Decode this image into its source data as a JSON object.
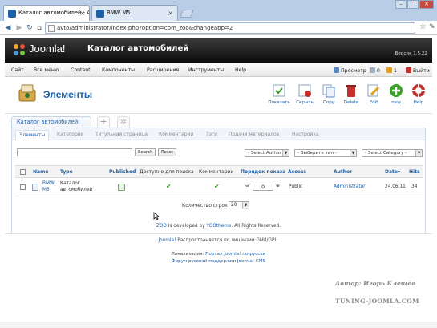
{
  "browser": {
    "tabs": [
      {
        "label": "Каталог автомобилей - А",
        "active": true
      },
      {
        "label": "BMW M5",
        "active": false
      }
    ],
    "url": "avto/administrator/index.php?option=com_zoo&changeapp=2",
    "controls": {
      "minimize": "–",
      "maximize": "□",
      "close": "✕"
    },
    "icons": [
      "back-arrow-icon",
      "forward-arrow-icon",
      "reload-icon",
      "home-icon",
      "star-icon",
      "wrench-icon"
    ]
  },
  "header": {
    "brand": "Joomla!",
    "site_name": "Каталог автомобилей",
    "version": "Версия 1.5.22"
  },
  "menu": {
    "items": [
      "Сайт",
      "Все меню",
      "Content",
      "Компоненты",
      "Расширения",
      "Инструменты",
      "Help"
    ],
    "status": [
      {
        "label": "Просмотр"
      },
      {
        "label": "0"
      },
      {
        "label": "1"
      },
      {
        "label": "Выйти"
      }
    ]
  },
  "toolbar": {
    "title": "Элементы",
    "buttons": [
      {
        "label": "Показать",
        "color": "#3aa227"
      },
      {
        "label": "Скрыть",
        "color": "#c4302b"
      },
      {
        "label": "Copy",
        "color": "#5a8ac4"
      },
      {
        "label": "Delete",
        "color": "#c4302b"
      },
      {
        "label": "Edit",
        "color": "#e0a020"
      },
      {
        "label": "new",
        "color": "#3aa227"
      },
      {
        "label": "Help",
        "color": "#c4302b"
      }
    ]
  },
  "app_tabs": {
    "main": "Каталог автомобилей",
    "plus": "+",
    "gear": "✲"
  },
  "subtabs": [
    "Элементы",
    "Категории",
    "Титульная страница",
    "Комментарии",
    "Тэги",
    "Подачи материалов",
    "Настройка"
  ],
  "filters": {
    "search_value": "",
    "search_button": "Search",
    "reset_button": "Reset",
    "author": "- Select Author -",
    "type": "- Выберите тип -",
    "category": "- Select Category -"
  },
  "table": {
    "headers": {
      "name": "Name",
      "type": "Type",
      "published": "Published",
      "searchable": "Доступно для поиска",
      "comments": "Комментарии",
      "order": "Порядок показа",
      "access": "Access",
      "author": "Author",
      "date": "Date",
      "date_arrow": "▾",
      "hits": "Hits"
    },
    "rows": [
      {
        "name_line1": "BMW",
        "name_line2": "M5",
        "type_line1": "Каталог",
        "type_line2": "автомобилей",
        "published": true,
        "searchable": true,
        "comments": true,
        "order_down": "⊖",
        "order": "0",
        "order_up": "⊕",
        "access": "Public",
        "author": "Administrator",
        "date": "24.06.11",
        "hits": "34"
      }
    ]
  },
  "pager": {
    "label": "Количество строк",
    "value": "20"
  },
  "footer": {
    "zoo_prefix": "ZOO",
    "zoo_middle": " is developed by ",
    "zoo_link": "YOOtheme",
    "zoo_suffix": ". All Rights Reserved.",
    "joomla_link": "Joomla!",
    "joomla_text": " Распространяется по лицензии GNU/GPL.",
    "localization_label": "Локализация: ",
    "localization_link": "Портал Joomla! по-русски",
    "forum_link": "Форум русской поддержки Joomla! CMS"
  },
  "watermark": {
    "author": "Автор: Игорь Клещёв",
    "site": "TUNING-JOOMLA.COM"
  },
  "colors": {
    "accent": "#1d5fa6",
    "check": "#3aa227",
    "header_bg": "#111111"
  }
}
